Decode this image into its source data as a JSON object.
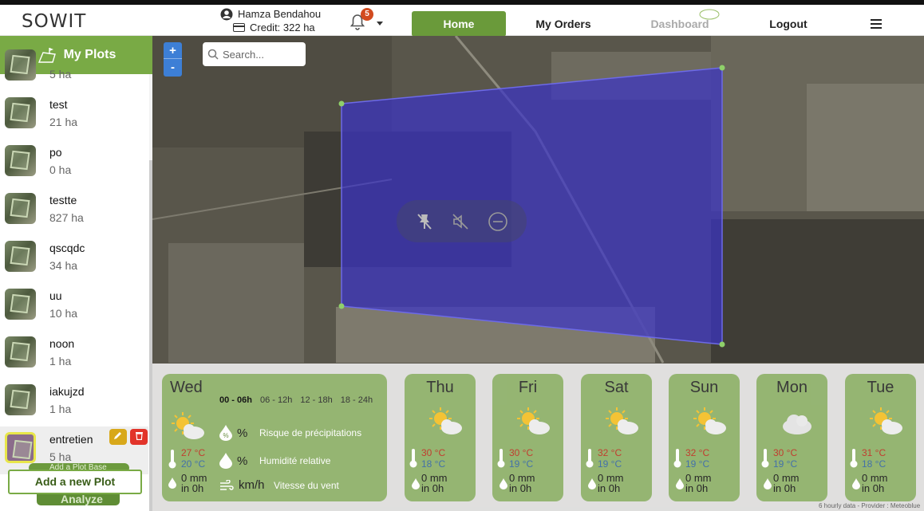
{
  "header": {
    "logo": "SOWIT",
    "user_name": "Hamza Bendahou",
    "credit": "Credit: 322 ha",
    "notifications_count": "5",
    "nav": {
      "home": "Home",
      "orders": "My Orders",
      "dashboard": "Dashboard",
      "logout": "Logout"
    }
  },
  "sidebar": {
    "title": "My Plots",
    "partial_item_area": "5 ha",
    "plots": [
      {
        "name": "test",
        "area": "21 ha"
      },
      {
        "name": "po",
        "area": "0 ha"
      },
      {
        "name": "testte",
        "area": "827 ha"
      },
      {
        "name": "qscqdc",
        "area": "34 ha"
      },
      {
        "name": "uu",
        "area": "10 ha"
      },
      {
        "name": "noon",
        "area": "1 ha"
      },
      {
        "name": "iakujzd",
        "area": "1 ha"
      },
      {
        "name": "entretien",
        "area": "5 ha"
      }
    ],
    "add_plot_base": "Add a Plot Base",
    "add_new_plot": "Add a new Plot",
    "analyze": "Analyze"
  },
  "map": {
    "search_placeholder": "Search...",
    "zoom_in": "+",
    "zoom_out": "-",
    "plot_fill_color": "#3a33c8"
  },
  "weather": {
    "today": {
      "day": "Wed",
      "periods": [
        "00 - 06h",
        "06 - 12h",
        "12 - 18h",
        "18 - 24h"
      ],
      "active_period": "00 - 06h",
      "metrics": [
        {
          "symbol": "%",
          "label": "Risque de précipitations"
        },
        {
          "symbol": "%",
          "label": "Humidité relative"
        },
        {
          "symbol": "km/h",
          "label": "Vitesse du vent"
        }
      ],
      "temp_high": "27 °C",
      "temp_low": "20 °C",
      "rain": "0 mm",
      "rain_time": "in 0h"
    },
    "days": [
      {
        "day": "Thu",
        "temp_high": "30 °C",
        "temp_low": "18 °C",
        "rain": "0 mm",
        "rain_time": "in 0h",
        "icon": "sun-cloud"
      },
      {
        "day": "Fri",
        "temp_high": "30 °C",
        "temp_low": "19 °C",
        "rain": "0 mm",
        "rain_time": "in 0h",
        "icon": "sun-cloud"
      },
      {
        "day": "Sat",
        "temp_high": "32 °C",
        "temp_low": "19 °C",
        "rain": "0 mm",
        "rain_time": "in 0h",
        "icon": "sun-cloud"
      },
      {
        "day": "Sun",
        "temp_high": "32 °C",
        "temp_low": "19 °C",
        "rain": "0 mm",
        "rain_time": "in 0h",
        "icon": "sun-cloud"
      },
      {
        "day": "Mon",
        "temp_high": "30 °C",
        "temp_low": "19 °C",
        "rain": "0 mm",
        "rain_time": "in 0h",
        "icon": "cloud"
      },
      {
        "day": "Tue",
        "temp_high": "31 °C",
        "temp_low": "18 °C",
        "rain": "0 mm",
        "rain_time": "in 0h",
        "icon": "sun-cloud"
      }
    ],
    "provider": "6 hourly data - Provider : Meteoblue"
  }
}
